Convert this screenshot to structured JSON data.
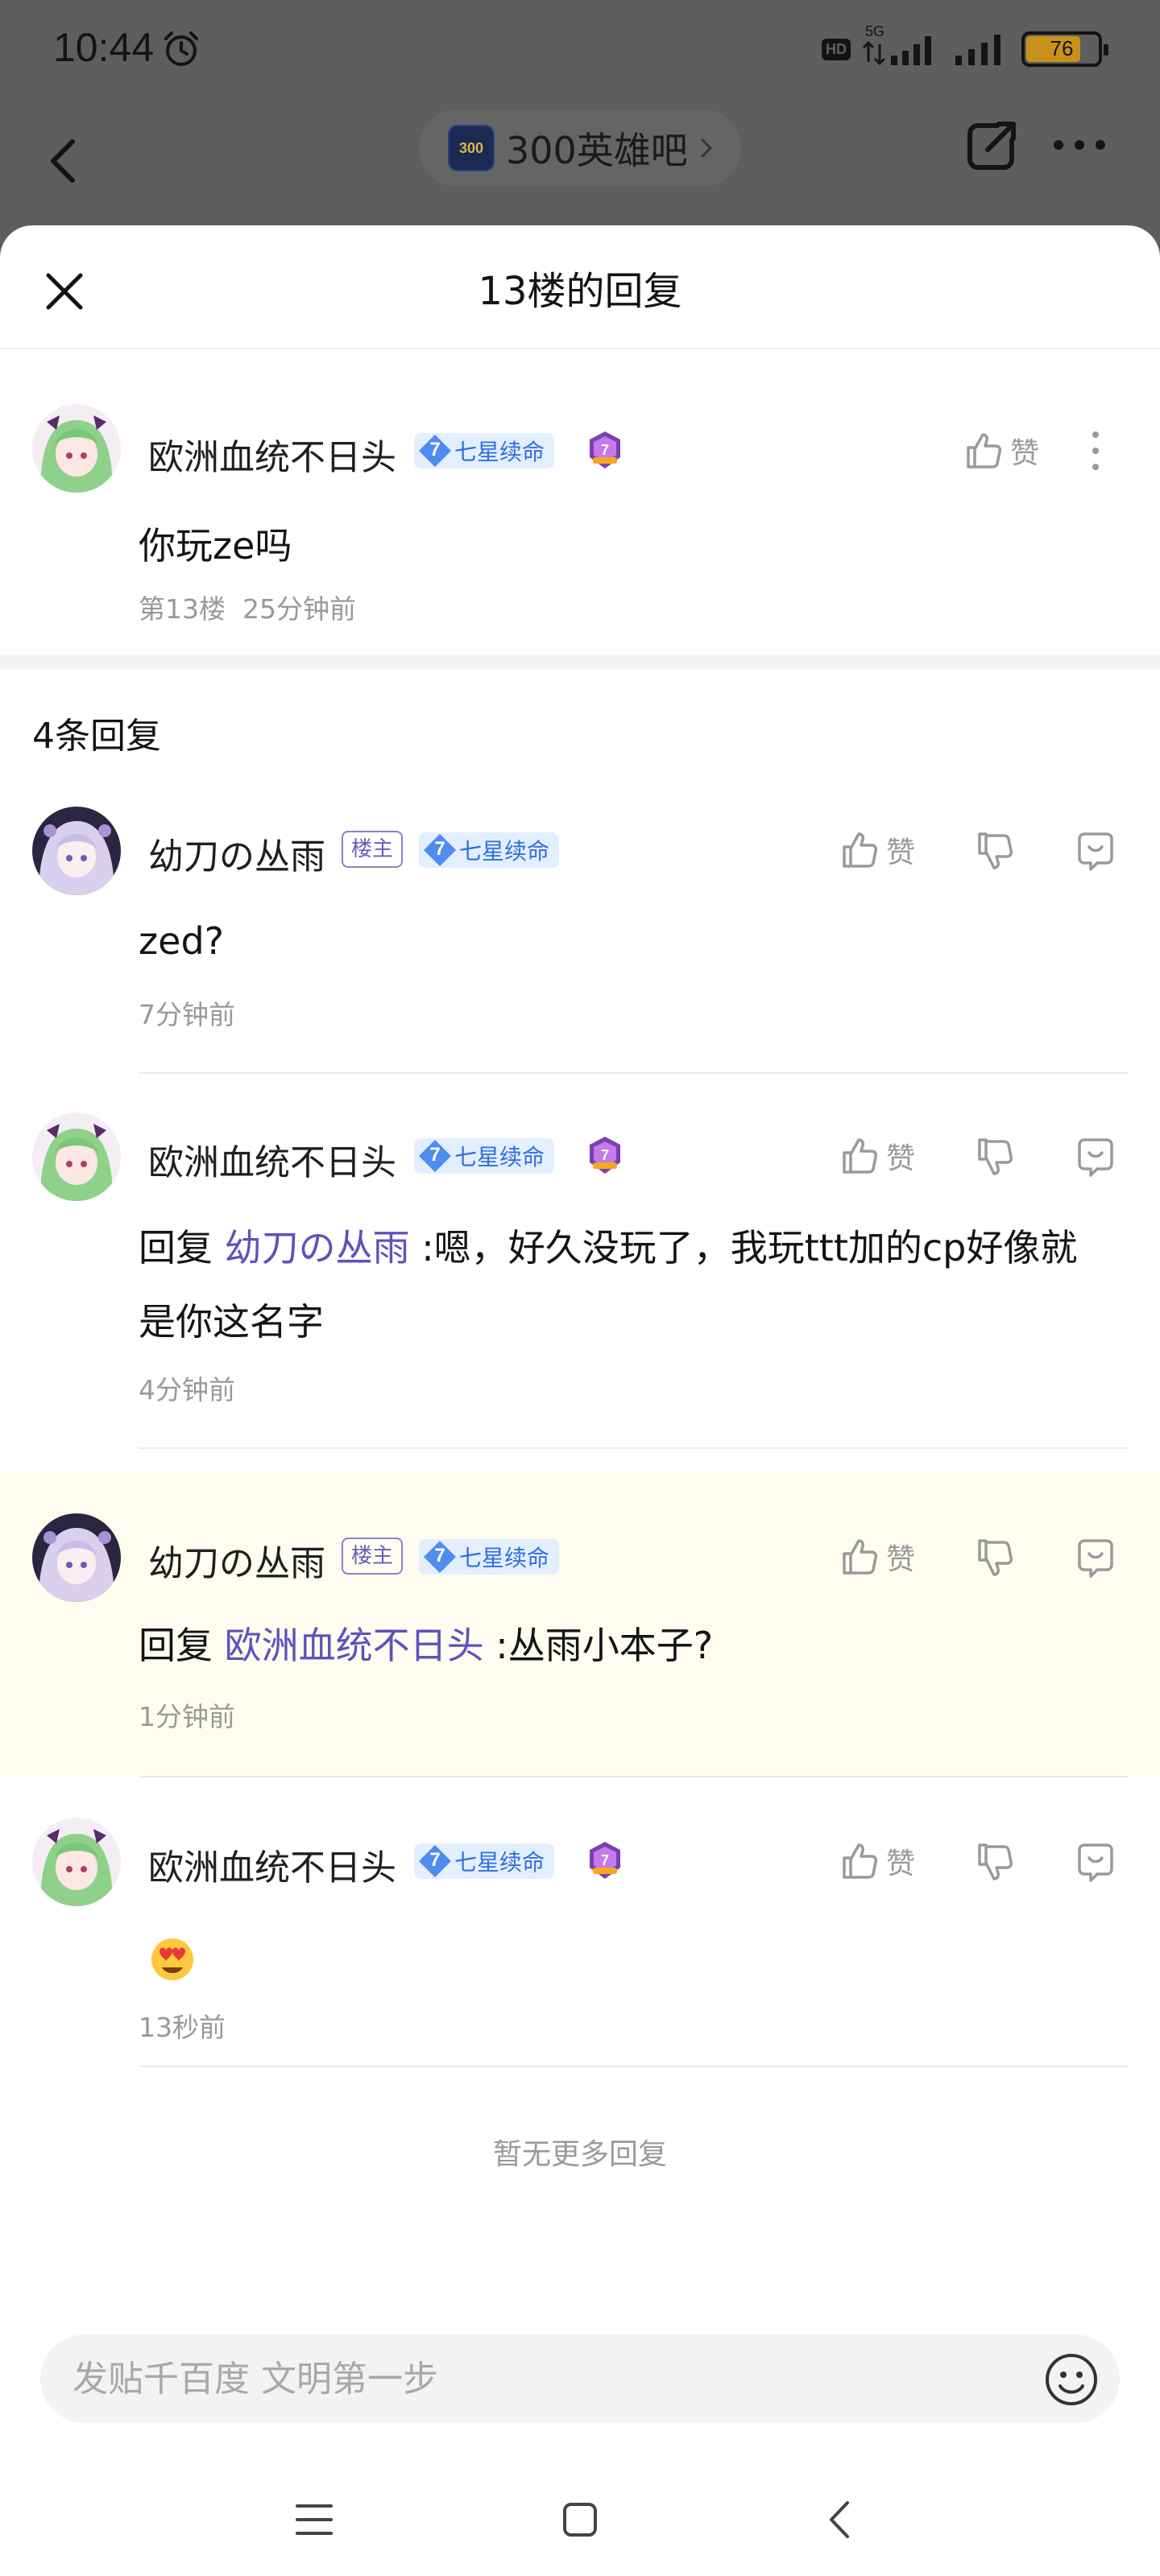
{
  "status_bar": {
    "time": "10:44",
    "hd": "HD",
    "network": "5G",
    "battery": "76",
    "battery_level": 0.76
  },
  "nav": {
    "forum_name": "300英雄吧",
    "forum_logo_text": "300"
  },
  "sheet": {
    "title": "13楼的回复"
  },
  "main_post": {
    "author": "欧洲血统不日头",
    "level": "7",
    "level_title": "七星续命",
    "medal_number": "7",
    "like_label": "赞",
    "content": "你玩ze吗",
    "floor": "第13楼",
    "time": "25分钟前"
  },
  "reply_count": "4条回复",
  "replies": [
    {
      "author": "幼刀の丛雨",
      "owner_tag": "楼主",
      "level": "7",
      "level_title": "七星续命",
      "like_label": "赞",
      "content": "zed?",
      "time": "7分钟前"
    },
    {
      "author": "欧洲血统不日头",
      "level": "7",
      "level_title": "七星续命",
      "medal_number": "7",
      "like_label": "赞",
      "reply_prefix": "回复 ",
      "mention": "幼刀の丛雨",
      "content": " :嗯，好久没玩了，我玩ttt加的cp好像就是你这名字",
      "time": "4分钟前"
    },
    {
      "author": "幼刀の丛雨",
      "owner_tag": "楼主",
      "level": "7",
      "level_title": "七星续命",
      "like_label": "赞",
      "reply_prefix": "回复 ",
      "mention": "欧洲血统不日头",
      "content": " :丛雨小本子?",
      "time": "1分钟前"
    },
    {
      "author": "欧洲血统不日头",
      "level": "7",
      "level_title": "七星续命",
      "medal_number": "7",
      "like_label": "赞",
      "content_emoji": "heart-eyes-emoji",
      "time": "13秒前"
    }
  ],
  "no_more": "暂无更多回复",
  "compose": {
    "placeholder": "发贴千百度 文明第一步"
  },
  "colors": {
    "accent": "#2f6ee0",
    "mention": "#6050c0",
    "highlight_bg": "#fffdf0"
  }
}
